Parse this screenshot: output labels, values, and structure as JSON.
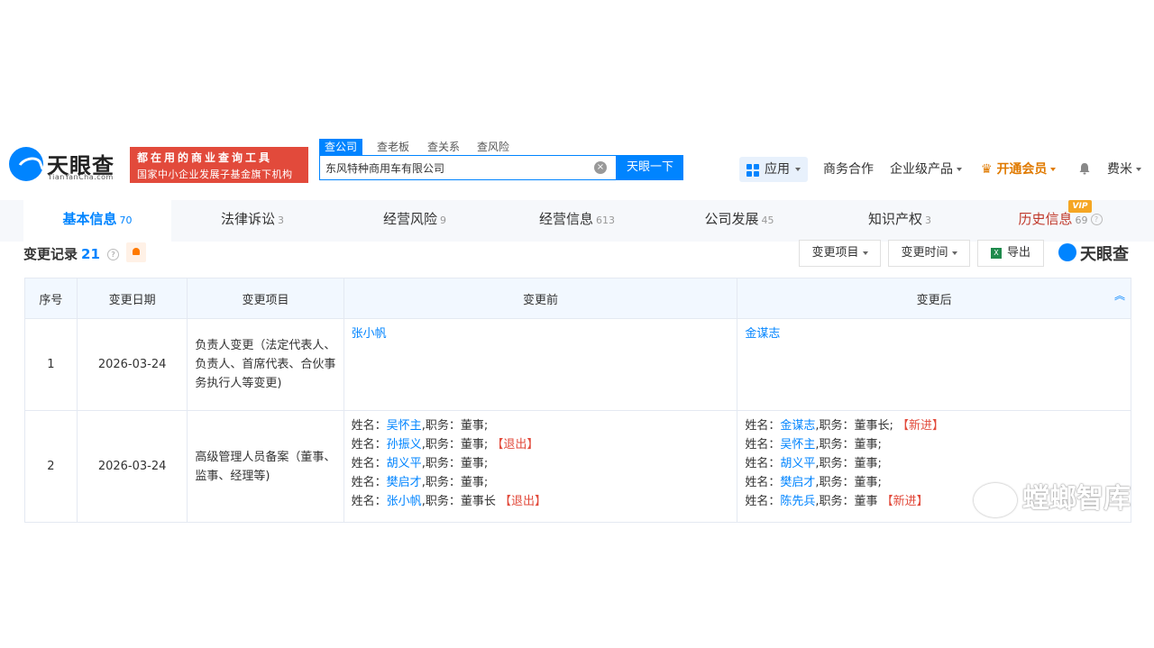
{
  "brand": {
    "name": "天眼查",
    "domain": "TianYanCha.com",
    "accent": "#0084ff"
  },
  "slogan": {
    "line1": "都在用的商业查询工具",
    "line2": "国家中小企业发展子基金旗下机构"
  },
  "search": {
    "tabs": [
      "查公司",
      "查老板",
      "查关系",
      "查风险"
    ],
    "value": "东风特种商用车有限公司",
    "button": "天眼一下"
  },
  "nav": {
    "apps": "应用",
    "business": "商务合作",
    "enterprise": "企业级产品",
    "vip": "开通会员",
    "user": "费米"
  },
  "main_tabs": [
    {
      "label": "基本信息",
      "count": "70"
    },
    {
      "label": "法律诉讼",
      "count": "3"
    },
    {
      "label": "经营风险",
      "count": "9"
    },
    {
      "label": "经营信息",
      "count": "613"
    },
    {
      "label": "公司发展",
      "count": "45"
    },
    {
      "label": "知识产权",
      "count": "3"
    },
    {
      "label": "历史信息",
      "count": "69"
    }
  ],
  "vip_badge": "VIP",
  "section": {
    "title": "变更记录",
    "count": "21",
    "filter_item": "变更项目",
    "filter_time": "变更时间",
    "export": "导出",
    "brand": "天眼查"
  },
  "table": {
    "headers": {
      "idx": "序号",
      "date": "变更日期",
      "item": "变更项目",
      "before": "变更前",
      "after": "变更后"
    },
    "rows": [
      {
        "idx": "1",
        "date": "2026-03-24",
        "item": "负责人变更（法定代表人、负责人、首席代表、合伙事务执行人等变更)",
        "before_name": "张小帆",
        "after_name": "金谋志"
      },
      {
        "idx": "2",
        "date": "2026-03-24",
        "item": "高级管理人员备案（董事、监事、经理等)",
        "before": [
          {
            "prefix": "姓名：",
            "name": "吴怀主",
            "sep": ",职务：",
            "role": "董事;",
            "tag": ""
          },
          {
            "prefix": "姓名：",
            "name": "孙振义",
            "sep": ",职务：",
            "role": "董事;",
            "tag": "【退出】"
          },
          {
            "prefix": "姓名：",
            "name": "胡义平",
            "sep": ",职务：",
            "role": "董事;",
            "tag": ""
          },
          {
            "prefix": "姓名：",
            "name": "樊启才",
            "sep": ",职务：",
            "role": "董事;",
            "tag": ""
          },
          {
            "prefix": "姓名：",
            "name": "张小帆",
            "sep": ",职务：",
            "role": "董事长",
            "tag": "【退出】"
          }
        ],
        "after": [
          {
            "prefix": "姓名：",
            "name": "金谋志",
            "sep": ",职务：",
            "role": "董事长;",
            "tag": "【新进】"
          },
          {
            "prefix": "姓名：",
            "name": "吴怀主",
            "sep": ",职务：",
            "role": "董事;",
            "tag": ""
          },
          {
            "prefix": "姓名：",
            "name": "胡义平",
            "sep": ",职务：",
            "role": "董事;",
            "tag": ""
          },
          {
            "prefix": "姓名：",
            "name": "樊启才",
            "sep": ",职务：",
            "role": "董事;",
            "tag": ""
          },
          {
            "prefix": "姓名：",
            "name": "陈先兵",
            "sep": ",职务：",
            "role": "董事",
            "tag": "【新进】"
          }
        ]
      }
    ]
  },
  "watermark": "螳螂智库"
}
